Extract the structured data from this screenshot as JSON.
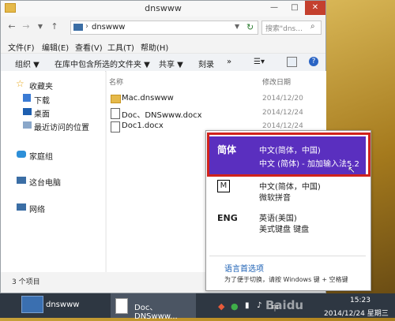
{
  "window": {
    "title": "dnswww",
    "controls": {
      "minimize": "—",
      "maximize": "□",
      "close": "✕"
    }
  },
  "address": {
    "path": "dnswww",
    "search_placeholder": "搜索\"dns...",
    "nav_icons": [
      "back-icon",
      "forward-icon",
      "up-icon",
      "refresh-icon"
    ]
  },
  "menubar": {
    "items": [
      "文件(F)",
      "编辑(E)",
      "查看(V)",
      "工具(T)",
      "帮助(H)"
    ]
  },
  "toolbar": {
    "organize": "组织 ▼",
    "include": "在库中包含所选的文件夹 ▼",
    "share": "共享 ▼",
    "burn": "刻录",
    "more": "»"
  },
  "navpane": {
    "favorites": "收藏夹",
    "downloads": "下载",
    "desktop": "桌面",
    "recent": "最近访问的位置",
    "homegroup": "家庭组",
    "computer": "这台电脑",
    "network": "网络"
  },
  "content": {
    "columns": {
      "name": "名称",
      "modified": "修改日期"
    },
    "files": [
      {
        "name": "Mac.dnswww",
        "date": "2014/12/20",
        "icon": "folder-icon"
      },
      {
        "name": "Doc、DNSwww.docx",
        "date": "2014/12/24",
        "icon": "word-document-icon"
      },
      {
        "name": "Doc1.docx",
        "date": "2014/12/24",
        "icon": "word-document-icon"
      }
    ]
  },
  "status": {
    "count": "3 个项目"
  },
  "language_popup": {
    "items": [
      {
        "code": "简体",
        "line1": "中文(简体，中国)",
        "line2": "中文 (简体) - 加加输入法5.2",
        "selected": true
      },
      {
        "code": "M",
        "line1": "中文(简体，中国)",
        "line2": "微软拼音",
        "selected": false
      },
      {
        "code": "ENG",
        "line1": "英语(美国)",
        "line2": "美式键盘 键盘",
        "selected": false
      }
    ],
    "prefs_link": "语言首选项",
    "hint": "为了便于切换，请按 Windows 键 + 空格键"
  },
  "taskbar": {
    "task1_label": "dnswww",
    "task2_label": "Doc、DNSwww...",
    "clock_time": "15:23",
    "clock_date": "2014/12/24 星期三"
  },
  "colors": {
    "accent_selected": "#5a2fbf",
    "highlight_frame": "#d0221c",
    "taskbar": "#2e3742",
    "link": "#1a5fb4"
  }
}
